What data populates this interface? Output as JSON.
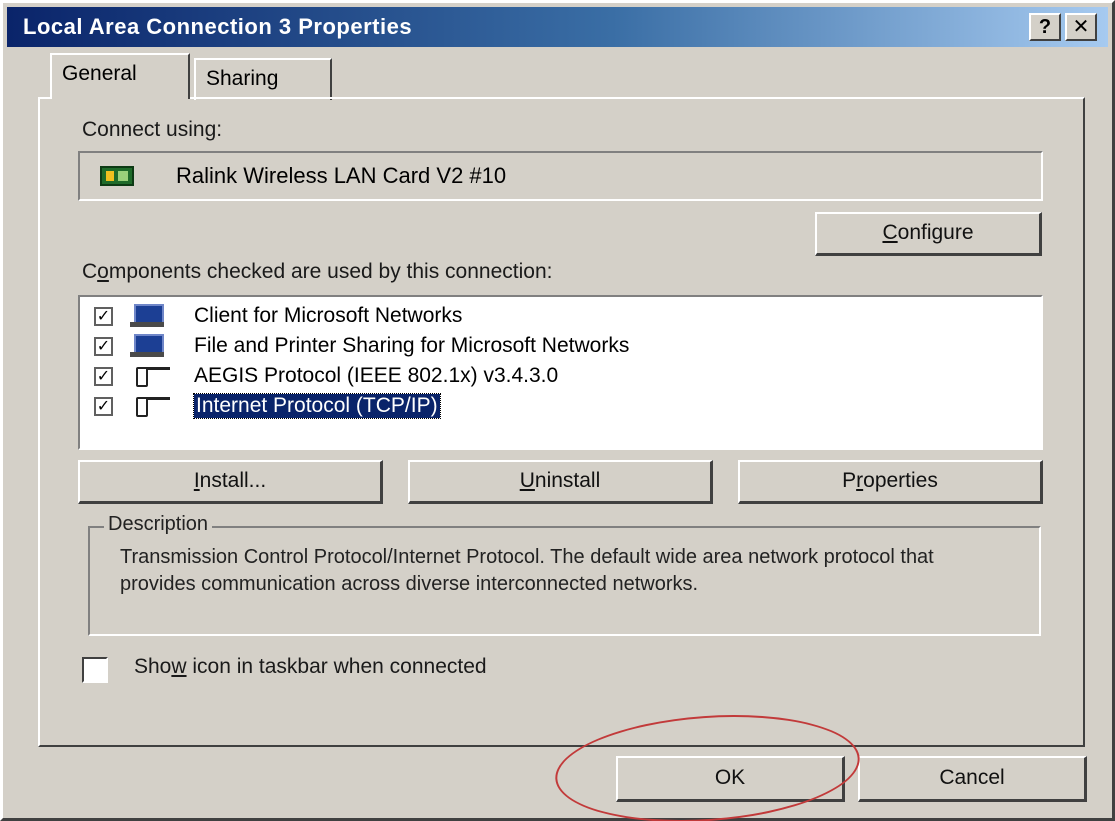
{
  "window": {
    "title": "Local Area Connection 3 Properties",
    "help_glyph": "?",
    "close_glyph": "✕"
  },
  "tabs": [
    {
      "label": "General",
      "active": true
    },
    {
      "label": "Sharing",
      "active": false
    }
  ],
  "connect_using": {
    "label": "Connect using:",
    "device": "Ralink Wireless LAN Card V2 #10",
    "device_icon": "network-card-icon"
  },
  "configure_button": {
    "prefix": "",
    "accel": "C",
    "rest": "onfigure"
  },
  "components": {
    "label_prefix": "C",
    "label_accel": "o",
    "label_rest": "mponents checked are used by this connection:",
    "items": [
      {
        "label": "Client for Microsoft Networks",
        "checked": true,
        "icon": "network-client-icon",
        "selected": false
      },
      {
        "label": "File and Printer Sharing for Microsoft Networks",
        "checked": true,
        "icon": "network-service-icon",
        "selected": false
      },
      {
        "label": "AEGIS Protocol (IEEE 802.1x) v3.4.3.0",
        "checked": true,
        "icon": "protocol-icon",
        "selected": false
      },
      {
        "label": "Internet Protocol (TCP/IP)",
        "checked": true,
        "icon": "protocol-icon",
        "selected": true
      }
    ],
    "check_glyph": "✓"
  },
  "buttons": {
    "install": {
      "prefix": "",
      "accel": "I",
      "rest": "nstall..."
    },
    "uninstall": {
      "prefix": "",
      "accel": "U",
      "rest": "ninstall"
    },
    "properties": {
      "prefix": "P",
      "accel": "r",
      "rest": "operties"
    },
    "ok": "OK",
    "cancel": "Cancel"
  },
  "description": {
    "legend": "Description",
    "text": "Transmission Control Protocol/Internet Protocol. The default wide area network protocol that provides communication across diverse interconnected networks."
  },
  "show_icon": {
    "prefix": "Sho",
    "accel": "w",
    "rest": " icon in taskbar when connected",
    "checked": false
  },
  "annotation_color": "#c23a3a"
}
